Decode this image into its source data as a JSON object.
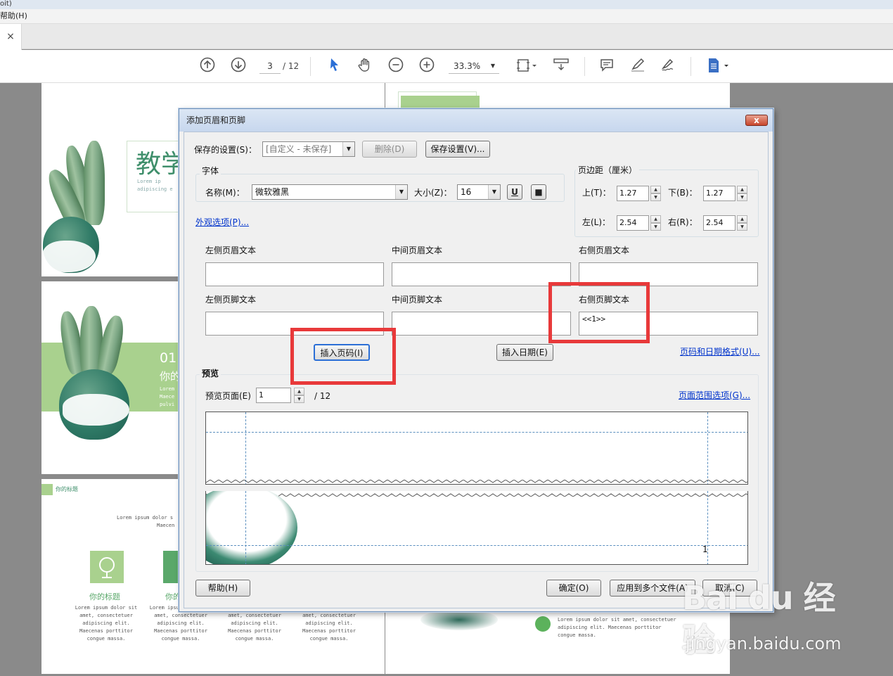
{
  "app": {
    "title_fragment": "oit)",
    "menu_fragment": "帮助(H)",
    "tab_close": "×"
  },
  "toolbar": {
    "prev_page_icon": "arrow-up-circle",
    "next_page_icon": "arrow-down-circle",
    "current_page": "3",
    "total_pages": "/ 12",
    "select_icon": "cursor-arrow",
    "hand_icon": "hand",
    "zoom_out_icon": "minus-circle",
    "zoom_in_icon": "plus-circle",
    "zoom_value": "33.3%",
    "fit_icon": "fit-page",
    "scroll_icon": "scroll-mode",
    "comment_icon": "speech-bubble",
    "highlight_icon": "pen",
    "sign_icon": "signature",
    "export_icon": "document"
  },
  "document": {
    "page1_title": "教学",
    "page1_lorem": [
      "Lorem ip",
      "adipiscing e"
    ],
    "page2_number": "01",
    "page2_heading": "你的",
    "page2_lorem": [
      "Lorem",
      "Maece",
      "pulvi"
    ],
    "page3_badge": "你的标题",
    "page3_lorem": [
      "Lorem ipsum dolor s",
      "Maecen"
    ],
    "cards": [
      {
        "title": "你的标题",
        "text": [
          "Lorem ipsum dolor sit",
          "amet, consectetuer",
          "adipiscing elit.",
          "Maecenas porttitor",
          "congue massa."
        ]
      },
      {
        "title": "你的",
        "text": [
          "Lorem ipsum dolor sit",
          "amet, consectetuer",
          "adipiscing elit.",
          "Maecenas porttitor",
          "congue massa."
        ]
      },
      {
        "title": "",
        "text": [
          "amet, consectetuer",
          "adipiscing elit.",
          "Maecenas porttitor",
          "congue massa."
        ]
      },
      {
        "title": "",
        "text": [
          "amet, consectetuer",
          "adipiscing elit.",
          "Maecenas porttitor",
          "congue massa."
        ]
      }
    ],
    "right_page_lorem": [
      "Lorem ipsum dolor sit amet, consectetuer",
      "adipiscing elit. Maecenas porttitor",
      "congue massa."
    ]
  },
  "dialog": {
    "title": "添加页眉和页脚",
    "close_label": "x",
    "saved_settings_label": "保存的设置(S)：",
    "saved_settings_value": "[自定义 - 未保存]",
    "delete_button": "删除(D)",
    "save_settings_button": "保存设置(V)...",
    "font_group": "字体",
    "font_name_label": "名称(M)：",
    "font_name_value": "微软雅黑",
    "font_size_label": "大小(Z)：",
    "font_size_value": "16",
    "underline_label": "U",
    "color_label": "■",
    "appearance_link": "外观选项(P)...",
    "margin_group": "页边距（厘米）",
    "margin_top_label": "上(T)：",
    "margin_top_value": "1.27",
    "margin_bottom_label": "下(B)：",
    "margin_bottom_value": "1.27",
    "margin_left_label": "左(L)：",
    "margin_left_value": "2.54",
    "margin_right_label": "右(R)：",
    "margin_right_value": "2.54",
    "left_header_label": "左侧页眉文本",
    "center_header_label": "中间页眉文本",
    "right_header_label": "右侧页眉文本",
    "left_footer_label": "左侧页脚文本",
    "center_footer_label": "中间页脚文本",
    "right_footer_label": "右侧页脚文本",
    "right_footer_value": "<<1>>",
    "insert_page_number_button": "插入页码(I)",
    "insert_date_button": "插入日期(E)",
    "page_date_format_link": "页码和日期格式(U)...",
    "preview_group": "预览",
    "preview_page_label": "预览页面(E)",
    "preview_page_value": "1",
    "preview_total": "/ 12",
    "page_range_link": "页面范围选项(G)...",
    "preview_footer_number": "1",
    "help_button": "帮助(H)",
    "ok_button": "确定(O)",
    "apply_multiple_button": "应用到多个文件(A)",
    "cancel_button": "取消(C)"
  },
  "watermark": {
    "logo": "Bai du 经验",
    "url": "jingyan.baidu.com"
  },
  "colors": {
    "highlight_red": "#e8393a",
    "brand_green": "#3f8f6b",
    "accent_green": "#a9d18e",
    "link_blue": "#0033cc"
  }
}
